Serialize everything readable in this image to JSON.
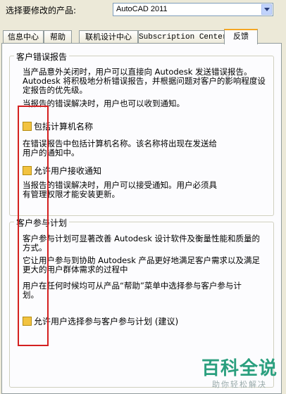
{
  "header": {
    "label": "选择要修改的产品:",
    "product_value": "AutoCAD 2011"
  },
  "tabs": [
    {
      "label": "信息中心"
    },
    {
      "label": "帮助"
    },
    {
      "label": "联机设计中心"
    },
    {
      "label": "Subscription Center"
    },
    {
      "label": "反馈",
      "active": true
    }
  ],
  "error_report": {
    "title": "客户错误报告",
    "intro_lines": [
      "当产品意外关闭时，用户可以直接向 Autodesk 发送错误报告。",
      "Autodesk 将积极地分析错误报告，并根据问题对客户的影响程度设",
      "定报告的优先级。"
    ],
    "notify_line": "当报告的错误解决时，用户也可以收到通知。",
    "checkbox1": {
      "label": "包括计算机名称",
      "desc_lines": [
        "在错误报告中包括计算机名称。该名称将出现在发送给",
        "用户的通知中。"
      ]
    },
    "checkbox2": {
      "label": "允许用户接收通知",
      "desc_lines": [
        "当报告的错误解决时，用户可以接受通知。用户必须具",
        "有管理权限才能安装更新。"
      ]
    }
  },
  "participation": {
    "title": "客户参与计划",
    "p1_lines": [
      "客户参与计划可显著改善 Autodesk 设计软件及衡量性能和质量的",
      "方式。"
    ],
    "p2_lines": [
      "它让用户参与到协助 Autodesk 产品更好地满足客户需求以及满足",
      "更大的用户群体需求的过程中"
    ],
    "p3_lines": [
      "用户在任何时候均可从产品“帮助”菜单中选择参与客户参与计",
      "划。"
    ],
    "checkbox": {
      "label": "允许用户选择参与客户参与计划 (建议)"
    }
  },
  "watermark": {
    "logo": "百科全说",
    "sub": "助你轻松解决"
  },
  "colors": {
    "highlight_border": "#d42020",
    "checkbox_fill": "#f2c340",
    "active_tab_accent": "#f5a623",
    "watermark_green": "#2a9f7e"
  }
}
